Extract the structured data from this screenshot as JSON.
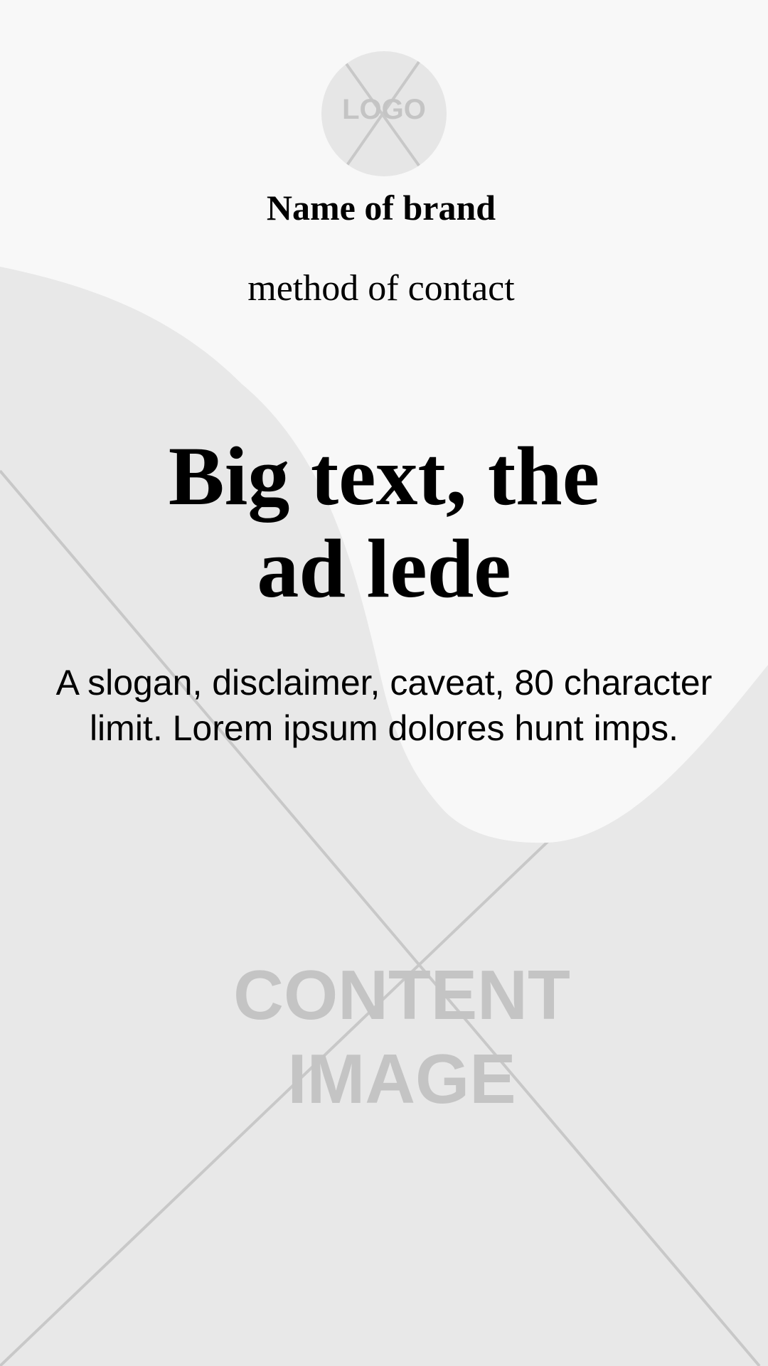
{
  "logo": {
    "text": "LOGO"
  },
  "brand": {
    "name": "Name of brand",
    "contact": "method of contact"
  },
  "ad": {
    "headline_line1": "Big text, the",
    "headline_line2": "ad lede",
    "slogan": "A slogan, disclaimer, caveat, 80 character limit. Lorem ipsum dolores hunt imps."
  },
  "content_image": {
    "label_line1": "CONTENT",
    "label_line2": "IMAGE"
  },
  "colors": {
    "page_background": "#e8e8e8",
    "panel_background": "#f8f8f8",
    "placeholder_stroke": "#c8c8c8",
    "placeholder_text": "#c4c4c4",
    "text": "#000000"
  }
}
